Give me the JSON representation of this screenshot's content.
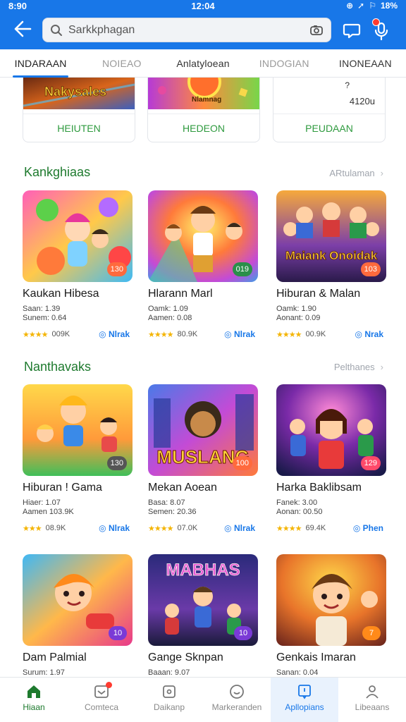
{
  "status": {
    "time_left": "8:90",
    "time_center": "12:04",
    "battery": "18%"
  },
  "search": {
    "value": "Sarkkphagan",
    "placeholder": ""
  },
  "tabs": [
    {
      "label": "INDARAAN",
      "active": true
    },
    {
      "label": "NOIEAO",
      "active": false
    },
    {
      "label": "Anlatyloean",
      "active": false
    },
    {
      "label": "INDOGIAN",
      "active": false
    },
    {
      "label": "INONEAAN",
      "active": false
    }
  ],
  "top_cards": [
    {
      "image_text": "Nakysales",
      "button": "HEIUTEN"
    },
    {
      "image_text": "Nlamnag",
      "button": "HEDEON"
    },
    {
      "tick": "?",
      "price": "4120u",
      "button": "PEUDAAN"
    }
  ],
  "section1": {
    "title": "Kankghiaas",
    "more": "ARtulaman",
    "cards": [
      {
        "title": "Kaukan Hibesa",
        "meta1": "Saan: 1.39",
        "meta2": "Sunem: 0.64",
        "rating": "★★★★",
        "count": "009K",
        "link": "Nlrak",
        "tag": "130"
      },
      {
        "title": "Hlarann Marl",
        "meta1": "Oamk: 1.09",
        "meta2": "Aamen: 0.08",
        "rating": "★★★★",
        "count": "80.9K",
        "link": "Nlrak",
        "tag": "019"
      },
      {
        "title": "Hiburan & Malan",
        "meta1": "Oamk: 1.90",
        "meta2": "Aonant: 0.09",
        "rating": "★★★★",
        "count": "00.9K",
        "link": "Nrak",
        "tag": "103",
        "image_text": "Maiank Onoidak"
      }
    ]
  },
  "section2": {
    "title": "Nanthavaks",
    "more": "Pelthanes",
    "cards": [
      {
        "title": "Hiburan ! Gama",
        "meta1": "Hiaer: 1.07",
        "meta2": "Aamen 103.9K",
        "rating": "★★★",
        "count": "08.9K",
        "link": "Nlrak",
        "tag": "130"
      },
      {
        "title": "Mekan Aoean",
        "meta1": "Basa: 8.07",
        "meta2": "Semen: 20.36",
        "rating": "★★★★",
        "count": "07.0K",
        "link": "Nlrak",
        "tag": "100",
        "image_text": "MUSLANG"
      },
      {
        "title": "Harka Baklibsam",
        "meta1": "Fanek: 3.00",
        "meta2": "Aonan: 00.50",
        "rating": "★★★★",
        "count": "69.4K",
        "link": "Phen",
        "tag": "129"
      }
    ]
  },
  "section3": {
    "cards": [
      {
        "title": "Dam Palmial",
        "meta1": "Surum: 1.97",
        "tag": "10"
      },
      {
        "title": "Gange Sknpan",
        "meta1": "Baaan: 9.07",
        "tag": "10",
        "image_text": "MABHAS"
      },
      {
        "title": "Genkais Imaran",
        "meta1": "Sanan: 0.04",
        "tag": "7"
      }
    ]
  },
  "bottom_nav": [
    {
      "label": "Hiaan",
      "icon": "home-icon",
      "active": false
    },
    {
      "label": "Comteca",
      "icon": "inbox-icon",
      "active": false,
      "badge": true
    },
    {
      "label": "Daikanp",
      "icon": "wallet-icon",
      "active": false
    },
    {
      "label": "Markeranden",
      "icon": "chat-circle-icon",
      "active": false
    },
    {
      "label": "Apllopians",
      "icon": "bookmark-chat-icon",
      "active": true
    },
    {
      "label": "Libeaans",
      "icon": "profile-icon",
      "active": false
    }
  ],
  "colors": {
    "brand_blue": "#1877e8",
    "green": "#1e7a2e",
    "star": "#f4b400"
  }
}
